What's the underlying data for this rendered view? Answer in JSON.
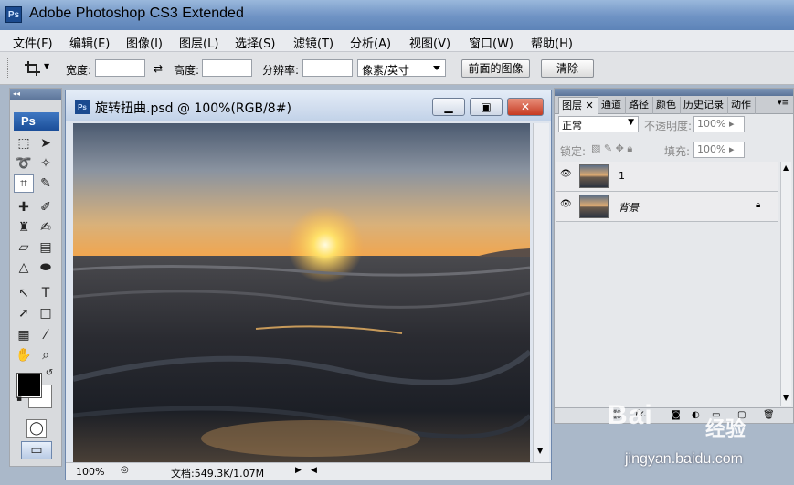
{
  "app": {
    "title": "Adobe Photoshop CS3 Extended",
    "logo": "Ps"
  },
  "menu": [
    "文件(F)",
    "编辑(E)",
    "图像(I)",
    "图层(L)",
    "选择(S)",
    "滤镜(T)",
    "分析(A)",
    "视图(V)",
    "窗口(W)",
    "帮助(H)"
  ],
  "options": {
    "width_label": "宽度:",
    "height_label": "高度:",
    "resolution_label": "分辨率:",
    "unit_value": "像素/英寸",
    "front_image_button": "前面的图像",
    "clear_button": "清除",
    "swap_icon": "⇄"
  },
  "toolbox": {
    "ps_label": "Ps"
  },
  "document": {
    "title": "旋转扭曲.psd @ 100%(RGB/8#)",
    "zoom": "100%",
    "doc_info": "文档:549.3K/1.07M",
    "icon": "Ps"
  },
  "layers_panel": {
    "tabs": [
      "图层",
      "通道",
      "路径",
      "颜色",
      "历史记录",
      "动作"
    ],
    "blend_mode": "正常",
    "opacity_label": "不透明度:",
    "opacity_value": "100%",
    "lock_label": "锁定:",
    "fill_label": "填充:",
    "fill_value": "100%",
    "layers": [
      {
        "name": "1",
        "visible": true,
        "locked": false
      },
      {
        "name": "背景",
        "visible": true,
        "locked": true
      }
    ]
  },
  "watermark": {
    "brand": "Bai",
    "brand2": "经验",
    "url": "jingyan.baidu.com"
  }
}
